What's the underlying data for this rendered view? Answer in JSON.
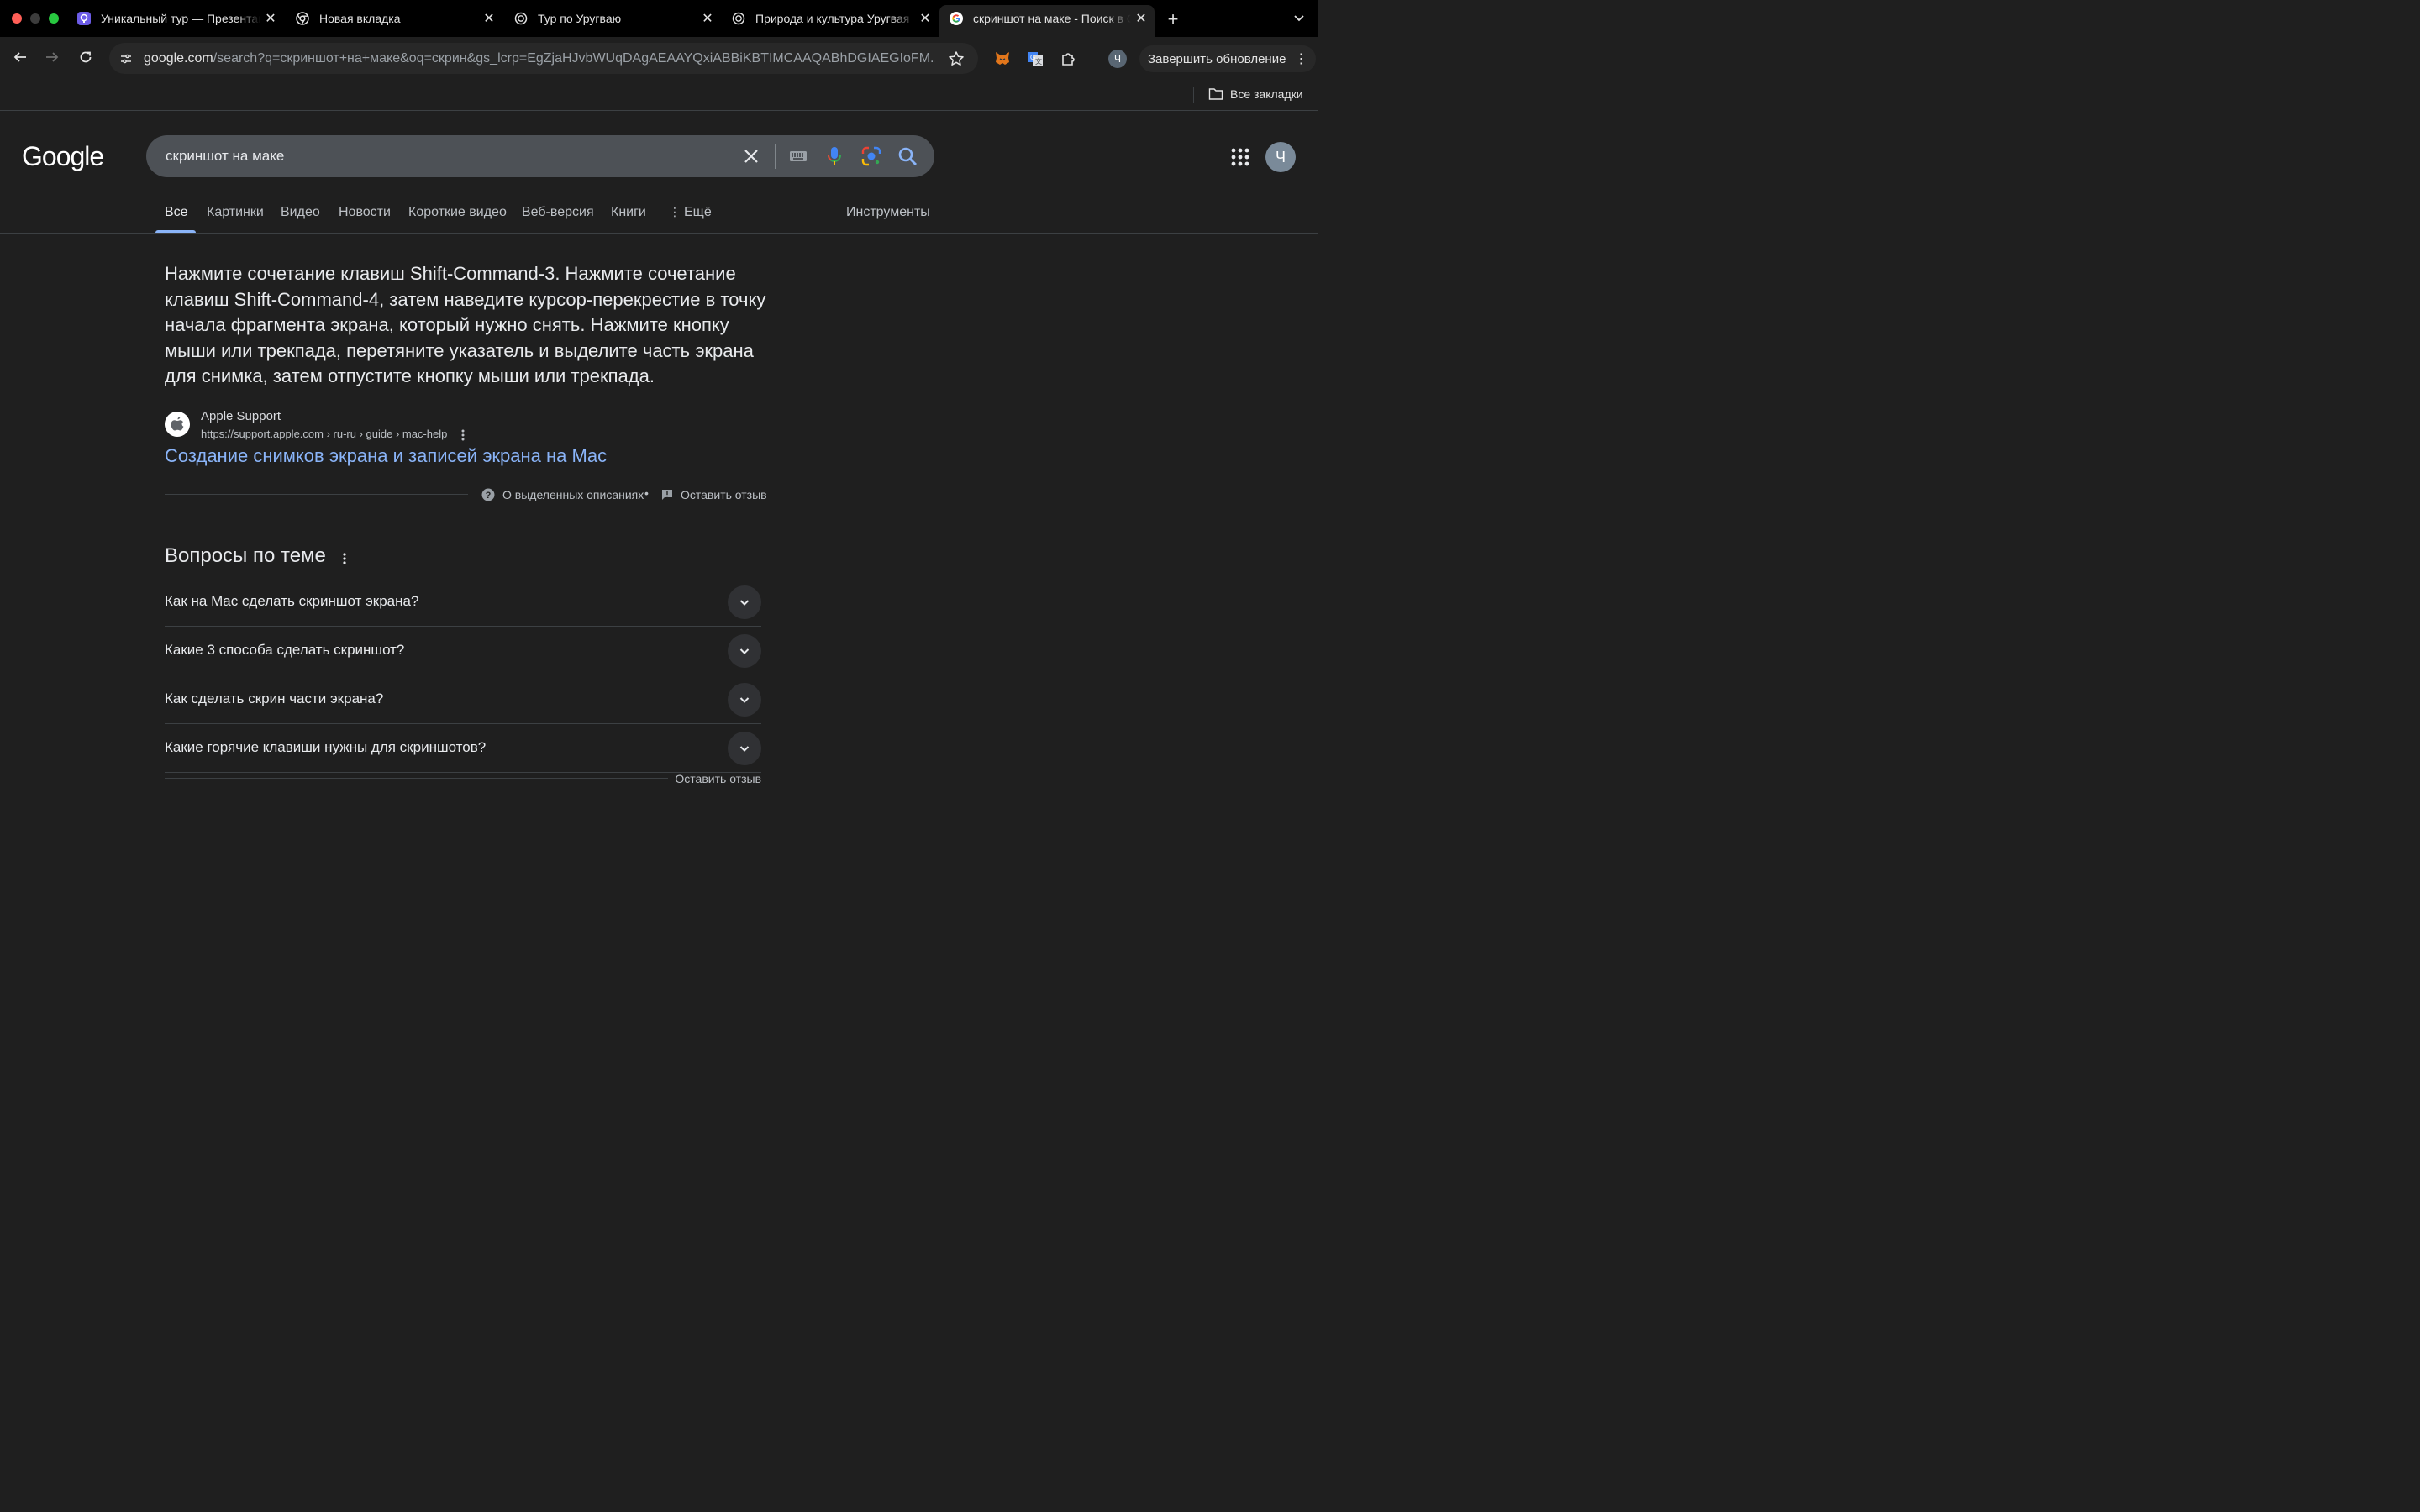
{
  "browser": {
    "tabs": [
      {
        "title": "Уникальный тур — Презентация",
        "active": false
      },
      {
        "title": "Новая вкладка",
        "active": false
      },
      {
        "title": "Тур по Уругваю",
        "active": false
      },
      {
        "title": "Природа и культура Уругвая",
        "active": false
      },
      {
        "title": "скриншот на маке - Поиск в Google",
        "active": true
      }
    ],
    "address": {
      "host": "google.com",
      "path": "/search?q=скриншот+на+маке&oq=скрин&gs_lcrp=EgZjaHJvbWUqDAgAEAAYQxiABBiKBTIMCAAQABhDGIAEGIoFM..."
    },
    "update_button": "Завершить обновление",
    "profile_initial": "Ч",
    "bookmarks": {
      "all_label": "Все закладки"
    }
  },
  "google": {
    "logo": "Google",
    "query": "скриншот на маке",
    "avatar_initial": "Ч",
    "tabs": [
      "Все",
      "Картинки",
      "Видео",
      "Новости",
      "Короткие видео",
      "Веб-версия",
      "Книги",
      "Ещё"
    ],
    "tools": "Инструменты"
  },
  "featured": {
    "snippet": "Нажмите сочетание клавиш Shift-Command-3. Нажмите сочетание клавиш Shift-Command-4, затем наведите курсор-перекрестие в точку начала фрагмента экрана, который нужно снять. Нажмите кнопку мыши или трекпада, перетяните указатель и выделите часть экрана для снимка, затем отпустите кнопку мыши или трекпада.",
    "source_name": "Apple Support",
    "source_cite": "https://support.apple.com › ru-ru › guide › mac-help",
    "link_title": "Создание снимков экрана и записей экрана на Mac",
    "about_label": "О выделенных описаниях",
    "separator": "•",
    "feedback_label": "Оставить отзыв"
  },
  "paa": {
    "title": "Вопросы по теме",
    "questions": [
      "Как на Mac сделать скриншот экрана?",
      "Какие 3 способа сделать скриншот?",
      "Как сделать скрин части экрана?",
      "Какие горячие клавиши нужны для скриншотов?"
    ],
    "feedback_label": "Оставить отзыв"
  },
  "colors": {
    "page_bg": "#1f1f1f",
    "link": "#8ab4f8",
    "accent_underline": "#8ab4f8"
  }
}
